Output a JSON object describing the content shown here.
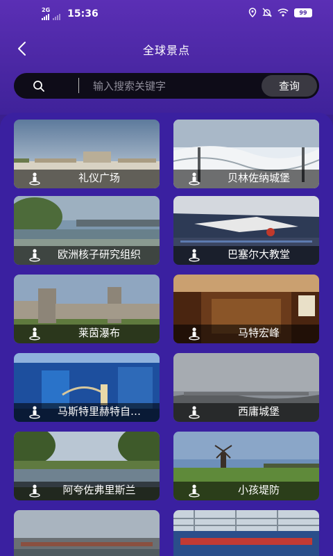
{
  "status": {
    "network": "2G",
    "time": "15:36",
    "battery": "99"
  },
  "header": {
    "title": "全球景点",
    "back_icon": "chevron-left-icon"
  },
  "search": {
    "placeholder": "输入搜索关键字",
    "value": "",
    "button_label": "查询"
  },
  "attractions": [
    {
      "name": "礼仪广场"
    },
    {
      "name": "贝林佐纳城堡"
    },
    {
      "name": "欧洲核子研究组织"
    },
    {
      "name": "巴塞尔大教堂"
    },
    {
      "name": "莱茵瀑布"
    },
    {
      "name": "马特宏峰"
    },
    {
      "name": "马斯特里赫特自…"
    },
    {
      "name": "西庸城堡"
    },
    {
      "name": "阿夸佐弗里斯兰"
    },
    {
      "name": "小孩堤防"
    },
    {
      "name": ""
    },
    {
      "name": ""
    }
  ]
}
